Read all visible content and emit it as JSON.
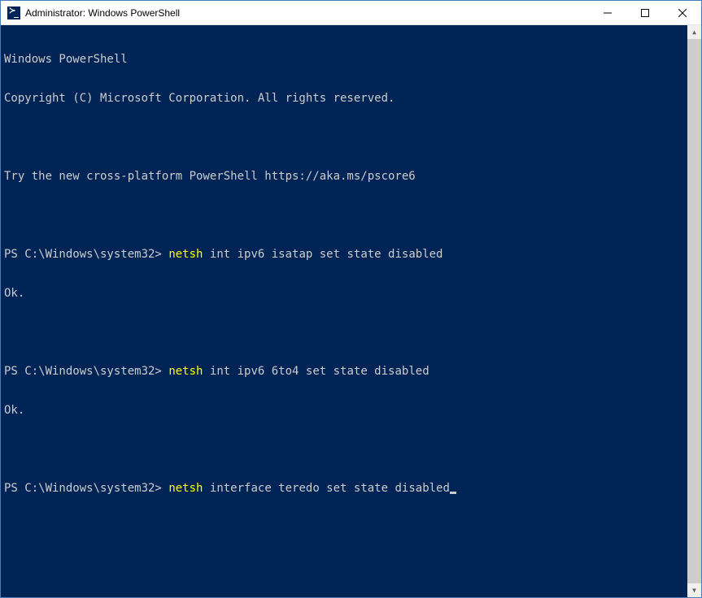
{
  "window": {
    "title": "Administrator: Windows PowerShell"
  },
  "terminal": {
    "header1": "Windows PowerShell",
    "header2": "Copyright (C) Microsoft Corporation. All rights reserved.",
    "tryMsg": "Try the new cross-platform PowerShell https://aka.ms/pscore6",
    "prompt": "PS C:\\Windows\\system32>",
    "cmd_word": "netsh",
    "lines": [
      {
        "args": " int ipv6 isatap set state disabled",
        "result": "Ok."
      },
      {
        "args": " int ipv6 6to4 set state disabled",
        "result": "Ok."
      }
    ],
    "current_args": " interface teredo set state disabled"
  }
}
